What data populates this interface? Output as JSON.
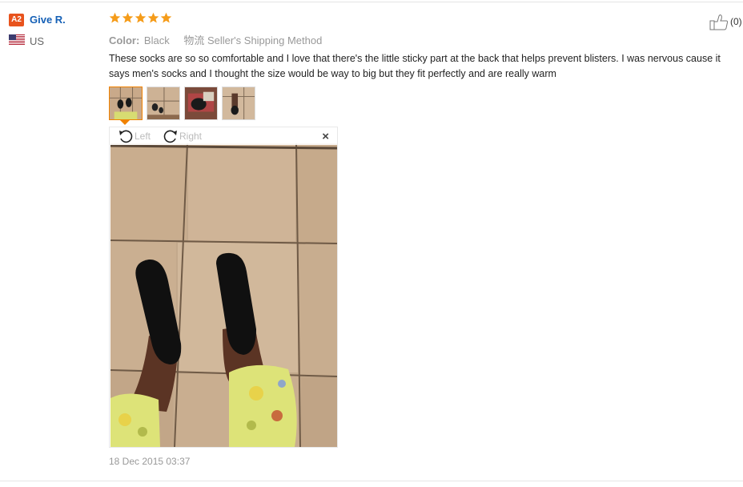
{
  "reviewer": {
    "badge": "A2",
    "name": "Give R.",
    "country": "US",
    "flag_icon": "us-flag-icon"
  },
  "rating": {
    "stars": 5,
    "max": 5,
    "color": "#f59c1a"
  },
  "likes": {
    "count": "(0)",
    "icon": "thumbs-up-icon"
  },
  "meta": {
    "color_label": "Color:",
    "color_value": "Black",
    "shipping": "物流 Seller's Shipping Method"
  },
  "review_text": "These socks are so so comfortable and I love that there's the little sticky part at the back that helps prevent blisters. I was nervous cause it says men's socks and I thought the size would be way to big but they fit perfectly and are really warm",
  "thumbnails": [
    {
      "name": "review-photo-1",
      "active": true
    },
    {
      "name": "review-photo-2",
      "active": false
    },
    {
      "name": "review-photo-3",
      "active": false
    },
    {
      "name": "review-photo-4",
      "active": false
    }
  ],
  "viewer": {
    "rotate_left_label": "Left",
    "rotate_right_label": "Right",
    "close_label": "×"
  },
  "date": "18 Dec 2015 03:37",
  "colors": {
    "accent": "#f08200",
    "link": "#1560b6",
    "badge": "#e8531d"
  }
}
